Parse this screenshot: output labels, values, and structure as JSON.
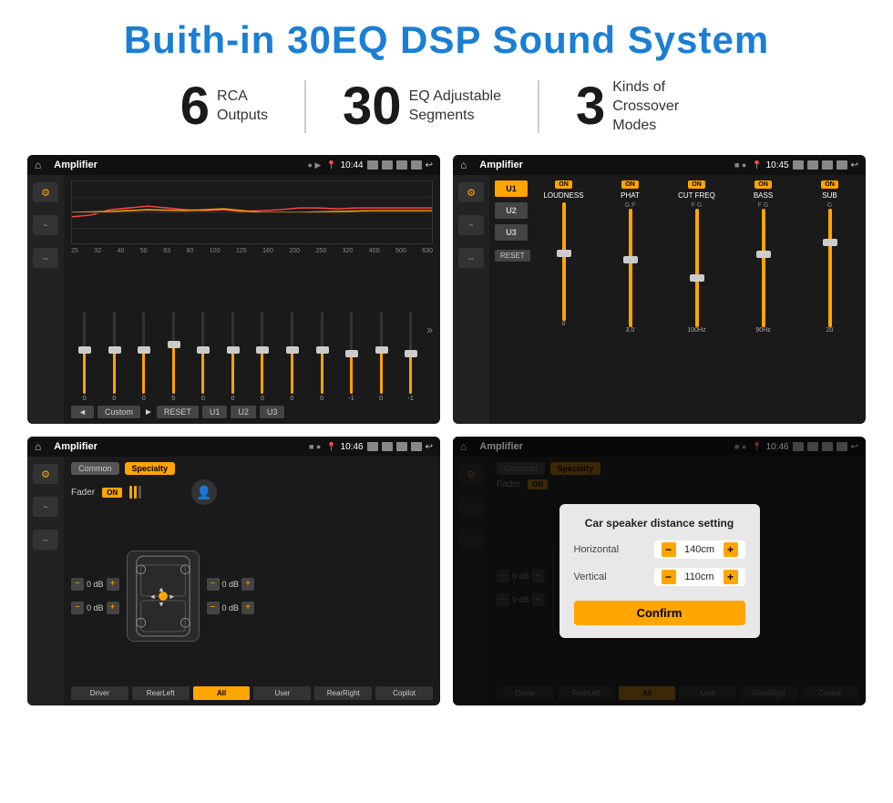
{
  "header": {
    "title": "Buith-in 30EQ DSP Sound System"
  },
  "stats": [
    {
      "number": "6",
      "label_line1": "RCA",
      "label_line2": "Outputs"
    },
    {
      "number": "30",
      "label_line1": "EQ Adjustable",
      "label_line2": "Segments"
    },
    {
      "number": "3",
      "label_line1": "Kinds of",
      "label_line2": "Crossover Modes"
    }
  ],
  "screens": {
    "eq_screen": {
      "status_title": "Amplifier",
      "time": "10:44",
      "freq_labels": [
        "25",
        "32",
        "40",
        "50",
        "63",
        "80",
        "100",
        "125",
        "160",
        "200",
        "250",
        "320",
        "400",
        "500",
        "630"
      ],
      "slider_values": [
        "0",
        "0",
        "0",
        "5",
        "0",
        "0",
        "0",
        "0",
        "0",
        "-1",
        "0",
        "-1"
      ],
      "preset_name": "Custom",
      "buttons": [
        "RESET",
        "U1",
        "U2",
        "U3"
      ]
    },
    "crossover_screen": {
      "status_title": "Amplifier",
      "time": "10:45",
      "presets": [
        "U1",
        "U2",
        "U3"
      ],
      "groups": [
        {
          "label": "LOUDNESS",
          "on": true
        },
        {
          "label": "PHAT",
          "on": true
        },
        {
          "label": "CUT FREQ",
          "on": true
        },
        {
          "label": "BASS",
          "on": true
        },
        {
          "label": "SUB",
          "on": true
        }
      ],
      "reset_label": "RESET"
    },
    "fader_screen": {
      "status_title": "Amplifier",
      "time": "10:46",
      "tabs": [
        "Common",
        "Specialty"
      ],
      "fader_label": "Fader",
      "fader_on": "ON",
      "db_values": [
        "0 dB",
        "0 dB",
        "0 dB",
        "0 dB"
      ],
      "bottom_buttons": [
        "Driver",
        "RearLeft",
        "All",
        "User",
        "RearRight",
        "Copilot"
      ]
    },
    "dialog_screen": {
      "status_title": "Amplifier",
      "time": "10:46",
      "dialog_title": "Car speaker distance setting",
      "horizontal_label": "Horizontal",
      "horizontal_value": "140cm",
      "vertical_label": "Vertical",
      "vertical_value": "110cm",
      "confirm_label": "Confirm",
      "db_values": [
        "0 dB",
        "0 dB"
      ]
    }
  }
}
